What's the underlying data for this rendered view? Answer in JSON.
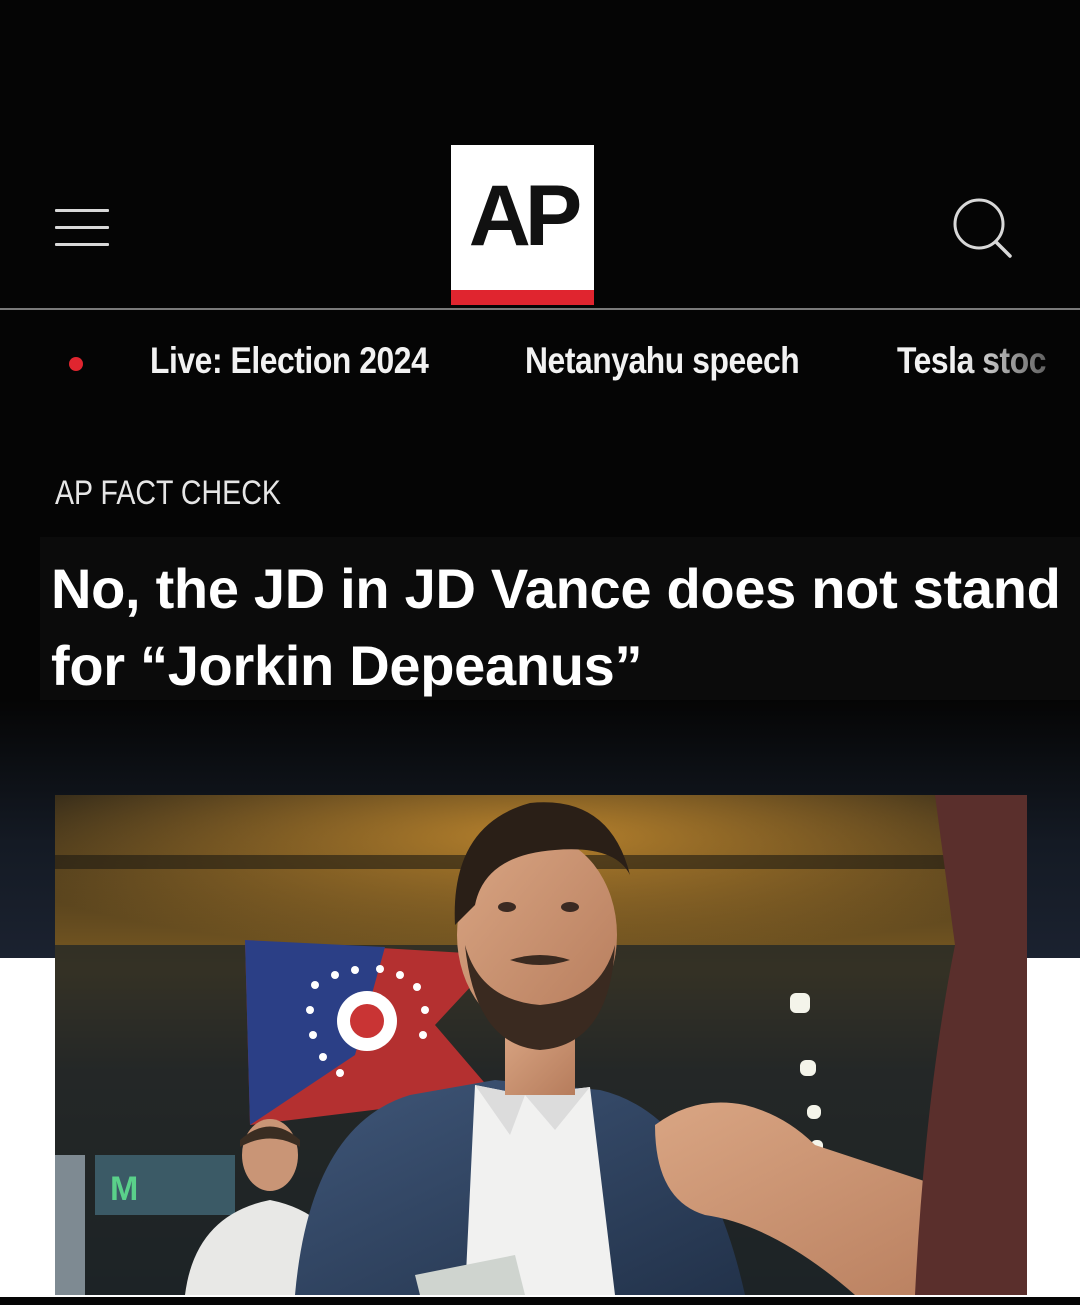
{
  "header": {
    "logo_text": "AP",
    "menu_icon": "hamburger-menu-icon",
    "search_icon": "search-icon"
  },
  "nav": {
    "items": [
      "Live: Election 2024",
      "Netanyahu speech",
      "Tesla stoc"
    ]
  },
  "article": {
    "kicker": "AP FACT CHECK",
    "headline": "No, the JD in JD Vance does not stand for “Jorkin Depeanus”"
  },
  "colors": {
    "background": "#050505",
    "ap_red": "#e0252f",
    "live_dot": "#e0252f",
    "text": "#ffffff"
  }
}
